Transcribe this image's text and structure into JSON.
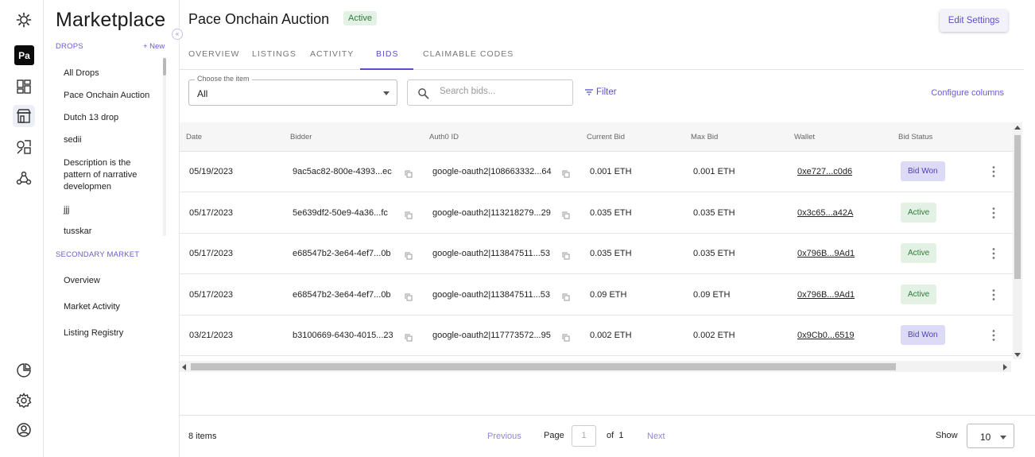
{
  "rail": {
    "logo_icon": "gear-sun-icon",
    "avatar_text": "Pa",
    "icons_top": [
      "dashboard-icon",
      "marketplace-store-icon",
      "design-tools-icon",
      "community-icon"
    ],
    "icons_bottom": [
      "analytics-pie-icon",
      "settings-gear-icon",
      "account-circle-icon"
    ]
  },
  "nav": {
    "title": "Marketplace",
    "drops_section": "DROPS",
    "new_label": "+ New",
    "collapse_icon": "«",
    "drops": [
      "All Drops",
      "Pace Onchain Auction",
      "Dutch 13 drop",
      "sedii",
      "Description is the pattern of narrative developmen",
      "jjj",
      "tusskar"
    ],
    "secondary_section": "SECONDARY MARKET",
    "secondary": [
      "Overview",
      "Market Activity",
      "Listing Registry"
    ]
  },
  "header": {
    "title": "Pace Onchain Auction",
    "status": "Active",
    "edit_button": "Edit Settings"
  },
  "tabs": [
    "OVERVIEW",
    "LISTINGS",
    "ACTIVITY",
    "BIDS",
    "CLAIMABLE CODES"
  ],
  "active_tab": "BIDS",
  "toolbar": {
    "item_select_label": "Choose the item",
    "item_select_value": "All",
    "search_placeholder": "Search bids...",
    "filter_label": "Filter",
    "configure_columns": "Configure columns"
  },
  "table": {
    "columns": [
      "Date",
      "Bidder",
      "Auth0 ID",
      "Current Bid",
      "Max Bid",
      "Wallet",
      "Bid Status"
    ],
    "rows": [
      {
        "date": "05/19/2023",
        "bidder": "9ac5ac82-800e-4393...ec",
        "auth0": "google-oauth2|108663332...64",
        "current": "0.001 ETH",
        "max": "0.001 ETH",
        "wallet": "0xe727...c0d6",
        "status": "Bid Won",
        "kind": "won"
      },
      {
        "date": "05/17/2023",
        "bidder": "5e639df2-50e9-4a36...fc",
        "auth0": "google-oauth2|113218279...29",
        "current": "0.035 ETH",
        "max": "0.035 ETH",
        "wallet": "0x3c65...a42A",
        "status": "Active",
        "kind": "active"
      },
      {
        "date": "05/17/2023",
        "bidder": "e68547b2-3e64-4ef7...0b",
        "auth0": "google-oauth2|113847511...53",
        "current": "0.035 ETH",
        "max": "0.035 ETH",
        "wallet": "0x796B...9Ad1",
        "status": "Active",
        "kind": "active"
      },
      {
        "date": "05/17/2023",
        "bidder": "e68547b2-3e64-4ef7...0b",
        "auth0": "google-oauth2|113847511...53",
        "current": "0.09 ETH",
        "max": "0.09 ETH",
        "wallet": "0x796B...9Ad1",
        "status": "Active",
        "kind": "active"
      },
      {
        "date": "03/21/2023",
        "bidder": "b3100669-6430-4015...23",
        "auth0": "google-oauth2|117773572...95",
        "current": "0.002 ETH",
        "max": "0.002 ETH",
        "wallet": "0x9Cb0...6519",
        "status": "Bid Won",
        "kind": "won"
      }
    ]
  },
  "footer": {
    "items_count": "8 items",
    "previous": "Previous",
    "page_label": "Page",
    "page_value": "1",
    "of_label": "of",
    "total_pages": "1",
    "next": "Next",
    "show_label": "Show",
    "show_value": "10"
  },
  "colors": {
    "accent": "#5b4fc9",
    "active_bg": "#e3f1e4",
    "active_text": "#2d7a3a",
    "won_bg": "#dcdaf6",
    "won_text": "#4c3fc0"
  }
}
